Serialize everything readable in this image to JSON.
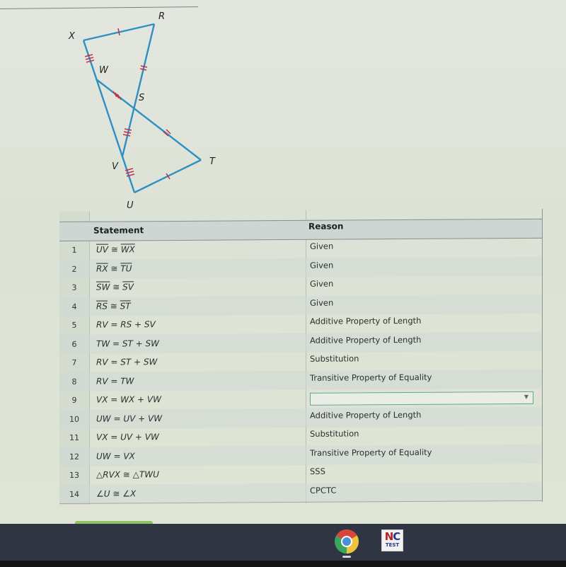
{
  "diagram": {
    "vertex_labels": {
      "X": "X",
      "R": "R",
      "W": "W",
      "S": "S",
      "V": "V",
      "T": "T",
      "U": "U"
    },
    "line_color": "#2f8fc1",
    "tick_color": "#c0324a"
  },
  "proof_table": {
    "headers": {
      "statement": "Statement",
      "reason": "Reason"
    },
    "rows": [
      {
        "num": "1",
        "statement": "UV ≅ WX",
        "reason": "Given"
      },
      {
        "num": "2",
        "statement": "RX ≅ TU",
        "reason": "Given"
      },
      {
        "num": "3",
        "statement": "SW ≅ SV",
        "reason": "Given"
      },
      {
        "num": "4",
        "statement": "RS ≅ ST",
        "reason": "Given"
      },
      {
        "num": "5",
        "statement": "RV = RS + SV",
        "reason": "Additive Property of Length"
      },
      {
        "num": "6",
        "statement": "TW = ST + SW",
        "reason": "Additive Property of Length"
      },
      {
        "num": "7",
        "statement": "RV = ST + SW",
        "reason": "Substitution"
      },
      {
        "num": "8",
        "statement": "RV = TW",
        "reason": "Transitive Property of Equality"
      },
      {
        "num": "9",
        "statement": "VX = WX + VW",
        "reason": ""
      },
      {
        "num": "10",
        "statement": "UW = UV + VW",
        "reason": "Additive Property of Length"
      },
      {
        "num": "11",
        "statement": "VX = UV + VW",
        "reason": "Substitution"
      },
      {
        "num": "12",
        "statement": "UW = VX",
        "reason": "Transitive Property of Equality"
      },
      {
        "num": "13",
        "statement": "△RVX ≅ △TWU",
        "reason": "SSS"
      },
      {
        "num": "14",
        "statement": "∠U ≅ ∠X",
        "reason": "CPCTC"
      }
    ],
    "overline_segments": {
      "1": [
        "UV",
        "WX"
      ],
      "2": [
        "RX",
        "TU"
      ],
      "3": [
        "SW",
        "SV"
      ],
      "4": [
        "RS",
        "ST"
      ]
    },
    "empty_select_row": "9",
    "select_accent": "#5fa6a0"
  },
  "taskbar": {
    "apps": [
      {
        "name": "Chrome",
        "icon": "chrome-icon",
        "active": true
      },
      {
        "name": "NC Test",
        "icon": "nc-test-icon",
        "label_top_n": "N",
        "label_top_c": "C",
        "label_bottom": "TEST"
      }
    ]
  }
}
